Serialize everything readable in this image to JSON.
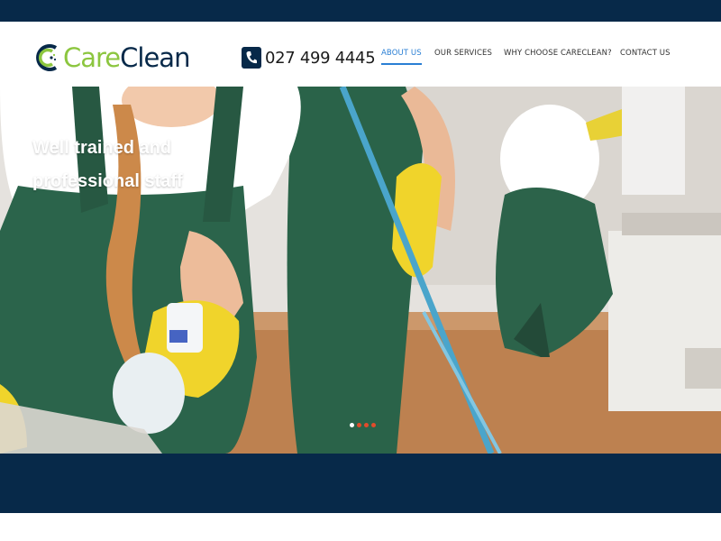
{
  "brand": {
    "logo_icon": "careclean-logo-icon",
    "name_part1": "Care",
    "name_part2": "Clean",
    "colors": {
      "navy": "#072949",
      "green": "#8cc63f",
      "accent_blue": "#2a7fd4",
      "slider_dot": "#e24b2b"
    }
  },
  "header": {
    "phone_icon": "phone-icon",
    "phone_number": "027 499 4445"
  },
  "nav": {
    "items": [
      {
        "label": "ABOUT US",
        "active": true
      },
      {
        "label": "OUR SERVICES",
        "active": false
      },
      {
        "label": "WHY CHOOSE CARECLEAN?",
        "active": false
      },
      {
        "label": "CONTACT US",
        "active": false
      }
    ]
  },
  "hero": {
    "title": "Well trained and professional staff",
    "slides_total": 4,
    "active_slide_index": 0
  }
}
